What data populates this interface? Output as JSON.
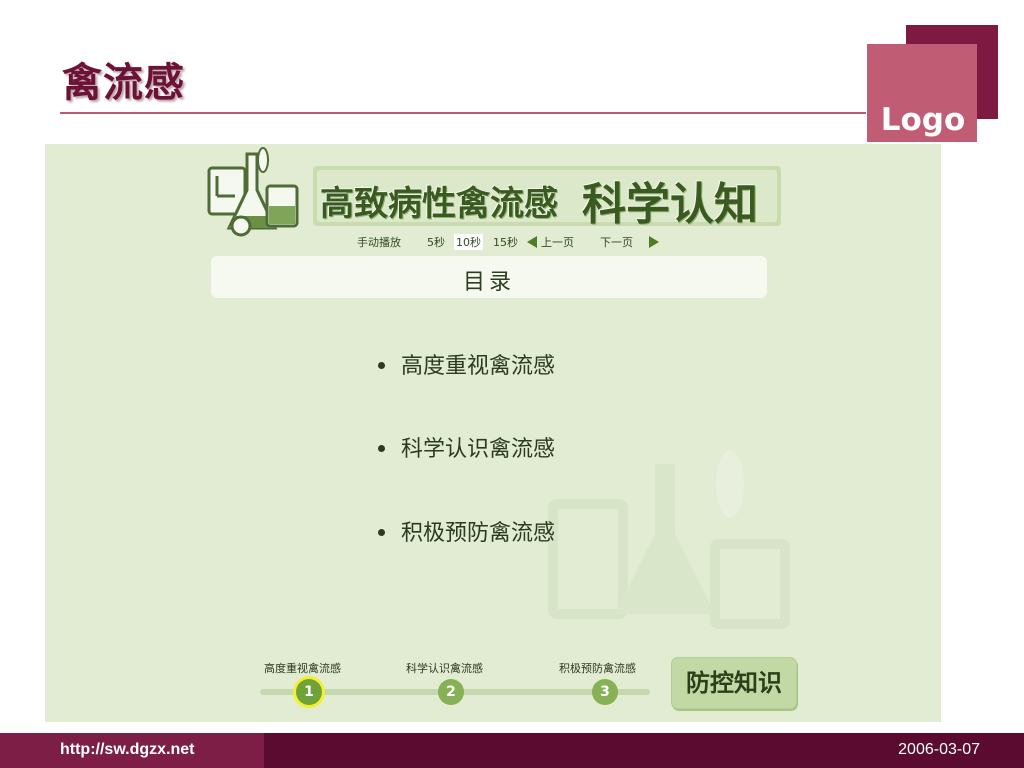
{
  "slide": {
    "title": "禽流感",
    "logo_text": "Logo",
    "footer_url": "http://sw.dgzx.net",
    "footer_date": "2006-03-07"
  },
  "embedded_app": {
    "banner_title": "高致病性禽流感",
    "banner_subtitle": "科学认知",
    "controls": {
      "manual": "手动播放",
      "s5": "5秒",
      "s10": "10秒",
      "s15": "15秒",
      "prev": "上一页",
      "next": "下一页",
      "selected": "10秒"
    },
    "toc_title": "目录",
    "menu": [
      "高度重视禽流感",
      "科学认识禽流感",
      "积极预防禽流感"
    ],
    "steps": [
      {
        "label": "高度重视禽流感",
        "number": "1",
        "active": true
      },
      {
        "label": "科学认识禽流感",
        "number": "2",
        "active": false
      },
      {
        "label": "积极预防禽流感",
        "number": "3",
        "active": false
      }
    ],
    "prevent_button": "防控知识"
  },
  "colors": {
    "title": "#6d1236",
    "logo_dark": "#7e1a42",
    "logo_light": "#c05d74",
    "panel_bg": "#e1ecd2",
    "accent_green": "#6fa33a",
    "footer_bg": "#5a0b2f"
  },
  "icons": [
    "lab-equipment-icon",
    "triangle-left-icon",
    "triangle-right-icon",
    "flask-watermark-icon"
  ]
}
